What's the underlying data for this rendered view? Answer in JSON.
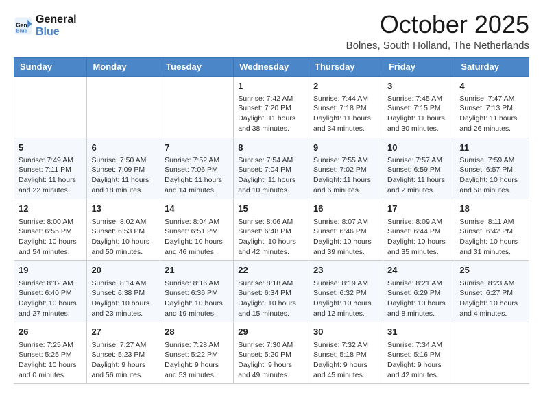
{
  "header": {
    "logo_line1": "General",
    "logo_line2": "Blue",
    "title": "October 2025",
    "subtitle": "Bolnes, South Holland, The Netherlands"
  },
  "days_of_week": [
    "Sunday",
    "Monday",
    "Tuesday",
    "Wednesday",
    "Thursday",
    "Friday",
    "Saturday"
  ],
  "weeks": [
    [
      {
        "day": "",
        "info": ""
      },
      {
        "day": "",
        "info": ""
      },
      {
        "day": "",
        "info": ""
      },
      {
        "day": "1",
        "info": "Sunrise: 7:42 AM\nSunset: 7:20 PM\nDaylight: 11 hours\nand 38 minutes."
      },
      {
        "day": "2",
        "info": "Sunrise: 7:44 AM\nSunset: 7:18 PM\nDaylight: 11 hours\nand 34 minutes."
      },
      {
        "day": "3",
        "info": "Sunrise: 7:45 AM\nSunset: 7:15 PM\nDaylight: 11 hours\nand 30 minutes."
      },
      {
        "day": "4",
        "info": "Sunrise: 7:47 AM\nSunset: 7:13 PM\nDaylight: 11 hours\nand 26 minutes."
      }
    ],
    [
      {
        "day": "5",
        "info": "Sunrise: 7:49 AM\nSunset: 7:11 PM\nDaylight: 11 hours\nand 22 minutes."
      },
      {
        "day": "6",
        "info": "Sunrise: 7:50 AM\nSunset: 7:09 PM\nDaylight: 11 hours\nand 18 minutes."
      },
      {
        "day": "7",
        "info": "Sunrise: 7:52 AM\nSunset: 7:06 PM\nDaylight: 11 hours\nand 14 minutes."
      },
      {
        "day": "8",
        "info": "Sunrise: 7:54 AM\nSunset: 7:04 PM\nDaylight: 11 hours\nand 10 minutes."
      },
      {
        "day": "9",
        "info": "Sunrise: 7:55 AM\nSunset: 7:02 PM\nDaylight: 11 hours\nand 6 minutes."
      },
      {
        "day": "10",
        "info": "Sunrise: 7:57 AM\nSunset: 6:59 PM\nDaylight: 11 hours\nand 2 minutes."
      },
      {
        "day": "11",
        "info": "Sunrise: 7:59 AM\nSunset: 6:57 PM\nDaylight: 10 hours\nand 58 minutes."
      }
    ],
    [
      {
        "day": "12",
        "info": "Sunrise: 8:00 AM\nSunset: 6:55 PM\nDaylight: 10 hours\nand 54 minutes."
      },
      {
        "day": "13",
        "info": "Sunrise: 8:02 AM\nSunset: 6:53 PM\nDaylight: 10 hours\nand 50 minutes."
      },
      {
        "day": "14",
        "info": "Sunrise: 8:04 AM\nSunset: 6:51 PM\nDaylight: 10 hours\nand 46 minutes."
      },
      {
        "day": "15",
        "info": "Sunrise: 8:06 AM\nSunset: 6:48 PM\nDaylight: 10 hours\nand 42 minutes."
      },
      {
        "day": "16",
        "info": "Sunrise: 8:07 AM\nSunset: 6:46 PM\nDaylight: 10 hours\nand 39 minutes."
      },
      {
        "day": "17",
        "info": "Sunrise: 8:09 AM\nSunset: 6:44 PM\nDaylight: 10 hours\nand 35 minutes."
      },
      {
        "day": "18",
        "info": "Sunrise: 8:11 AM\nSunset: 6:42 PM\nDaylight: 10 hours\nand 31 minutes."
      }
    ],
    [
      {
        "day": "19",
        "info": "Sunrise: 8:12 AM\nSunset: 6:40 PM\nDaylight: 10 hours\nand 27 minutes."
      },
      {
        "day": "20",
        "info": "Sunrise: 8:14 AM\nSunset: 6:38 PM\nDaylight: 10 hours\nand 23 minutes."
      },
      {
        "day": "21",
        "info": "Sunrise: 8:16 AM\nSunset: 6:36 PM\nDaylight: 10 hours\nand 19 minutes."
      },
      {
        "day": "22",
        "info": "Sunrise: 8:18 AM\nSunset: 6:34 PM\nDaylight: 10 hours\nand 15 minutes."
      },
      {
        "day": "23",
        "info": "Sunrise: 8:19 AM\nSunset: 6:32 PM\nDaylight: 10 hours\nand 12 minutes."
      },
      {
        "day": "24",
        "info": "Sunrise: 8:21 AM\nSunset: 6:29 PM\nDaylight: 10 hours\nand 8 minutes."
      },
      {
        "day": "25",
        "info": "Sunrise: 8:23 AM\nSunset: 6:27 PM\nDaylight: 10 hours\nand 4 minutes."
      }
    ],
    [
      {
        "day": "26",
        "info": "Sunrise: 7:25 AM\nSunset: 5:25 PM\nDaylight: 10 hours\nand 0 minutes."
      },
      {
        "day": "27",
        "info": "Sunrise: 7:27 AM\nSunset: 5:23 PM\nDaylight: 9 hours\nand 56 minutes."
      },
      {
        "day": "28",
        "info": "Sunrise: 7:28 AM\nSunset: 5:22 PM\nDaylight: 9 hours\nand 53 minutes."
      },
      {
        "day": "29",
        "info": "Sunrise: 7:30 AM\nSunset: 5:20 PM\nDaylight: 9 hours\nand 49 minutes."
      },
      {
        "day": "30",
        "info": "Sunrise: 7:32 AM\nSunset: 5:18 PM\nDaylight: 9 hours\nand 45 minutes."
      },
      {
        "day": "31",
        "info": "Sunrise: 7:34 AM\nSunset: 5:16 PM\nDaylight: 9 hours\nand 42 minutes."
      },
      {
        "day": "",
        "info": ""
      }
    ]
  ]
}
